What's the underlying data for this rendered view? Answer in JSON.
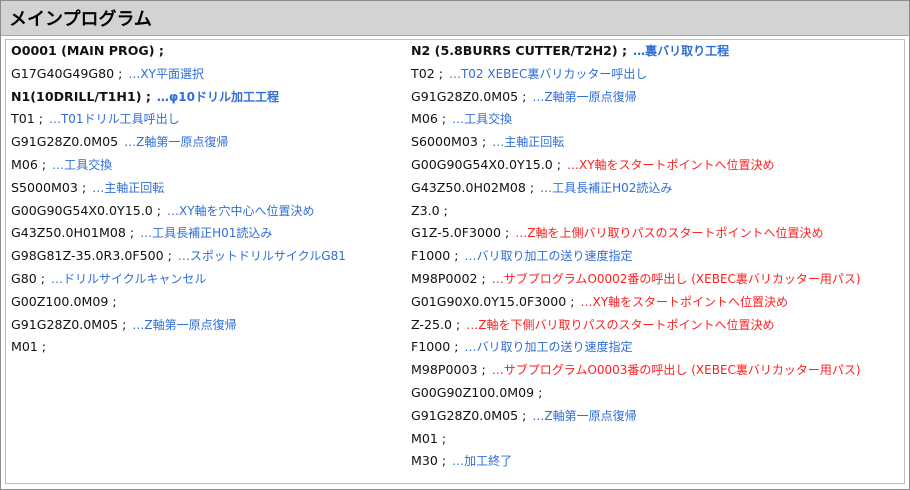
{
  "header": {
    "title": "メインプログラム"
  },
  "colors": {
    "comment_blue": "#2f6ed8",
    "comment_red": "#ff1f1f",
    "header_bg": "#d3d3d3"
  },
  "left": [
    {
      "code": "O0001 (MAIN PROG) ;",
      "comment": "",
      "bold": true,
      "red": false
    },
    {
      "code": "G17G40G49G80 ;",
      "comment": "…XY平面選択",
      "bold": false,
      "red": false
    },
    {
      "code": "N1(10DRILL/T1H1) ;",
      "comment": "…φ10ドリル加工工程",
      "bold": true,
      "red": false
    },
    {
      "code": "T01 ;",
      "comment": "…T01ドリル工具呼出し",
      "bold": false,
      "red": false
    },
    {
      "code": "G91G28Z0.0M05",
      "comment": "…Z軸第一原点復帰",
      "bold": false,
      "red": false
    },
    {
      "code": "M06 ;",
      "comment": "…工具交換",
      "bold": false,
      "red": false
    },
    {
      "code": "S5000M03 ;",
      "comment": "…主軸正回転",
      "bold": false,
      "red": false
    },
    {
      "code": "G00G90G54X0.0Y15.0 ;",
      "comment": "…XY軸を穴中心へ位置決め",
      "bold": false,
      "red": false
    },
    {
      "code": "G43Z50.0H01M08 ;",
      "comment": "…工具長補正H01読込み",
      "bold": false,
      "red": false
    },
    {
      "code": "G98G81Z-35.0R3.0F500 ;",
      "comment": "…スポットドリルサイクルG81",
      "bold": false,
      "red": false
    },
    {
      "code": "G80 ;",
      "comment": "…ドリルサイクルキャンセル",
      "bold": false,
      "red": false
    },
    {
      "code": "G00Z100.0M09 ;",
      "comment": "",
      "bold": false,
      "red": false
    },
    {
      "code": "G91G28Z0.0M05 ;",
      "comment": "…Z軸第一原点復帰",
      "bold": false,
      "red": false
    },
    {
      "code": "M01 ;",
      "comment": "",
      "bold": false,
      "red": false
    }
  ],
  "right": [
    {
      "code": "N2 (5.8BURRS CUTTER/T2H2) ;",
      "comment": "…裏バリ取り工程",
      "bold": true,
      "red": false
    },
    {
      "code": "T02 ;",
      "comment": "…T02 XEBEC裏バリカッター呼出し",
      "bold": false,
      "red": false
    },
    {
      "code": "G91G28Z0.0M05 ;",
      "comment": "…Z軸第一原点復帰",
      "bold": false,
      "red": false
    },
    {
      "code": "M06 ;",
      "comment": "…工具交換",
      "bold": false,
      "red": false
    },
    {
      "code": "S6000M03 ;",
      "comment": "…主軸正回転",
      "bold": false,
      "red": false
    },
    {
      "code": "G00G90G54X0.0Y15.0 ;",
      "comment": "…XY軸をスタートポイントへ位置決め",
      "bold": false,
      "red": true
    },
    {
      "code": "G43Z50.0H02M08 ;",
      "comment": "…工具長補正H02読込み",
      "bold": false,
      "red": false
    },
    {
      "code": "Z3.0 ;",
      "comment": "",
      "bold": false,
      "red": false
    },
    {
      "code": "G1Z-5.0F3000 ;",
      "comment": "…Z軸を上側バリ取りパスのスタートポイントへ位置決め",
      "bold": false,
      "red": true
    },
    {
      "code": "F1000 ;",
      "comment": "…バリ取り加工の送り速度指定",
      "bold": false,
      "red": false
    },
    {
      "code": "M98P0002 ;",
      "comment": "…サブプログラムO0002番の呼出し (XEBEC裏バリカッター用パス)",
      "bold": false,
      "red": true
    },
    {
      "code": "G01G90X0.0Y15.0F3000 ;",
      "comment": "…XY軸をスタートポイントへ位置決め",
      "bold": false,
      "red": true
    },
    {
      "code": "Z-25.0 ;",
      "comment": "…Z軸を下側バリ取りパスのスタートポイントへ位置決め",
      "bold": false,
      "red": true
    },
    {
      "code": "F1000 ;",
      "comment": "…バリ取り加工の送り速度指定",
      "bold": false,
      "red": false
    },
    {
      "code": "M98P0003 ;",
      "comment": "…サブプログラムO0003番の呼出し (XEBEC裏バリカッター用パス)",
      "bold": false,
      "red": true
    },
    {
      "code": "G00G90Z100.0M09 ;",
      "comment": "",
      "bold": false,
      "red": false
    },
    {
      "code": "G91G28Z0.0M05 ;",
      "comment": "…Z軸第一原点復帰",
      "bold": false,
      "red": false
    },
    {
      "code": "M01 ;",
      "comment": "",
      "bold": false,
      "red": false
    },
    {
      "code": "M30 ;",
      "comment": "…加工終了",
      "bold": false,
      "red": false
    }
  ]
}
